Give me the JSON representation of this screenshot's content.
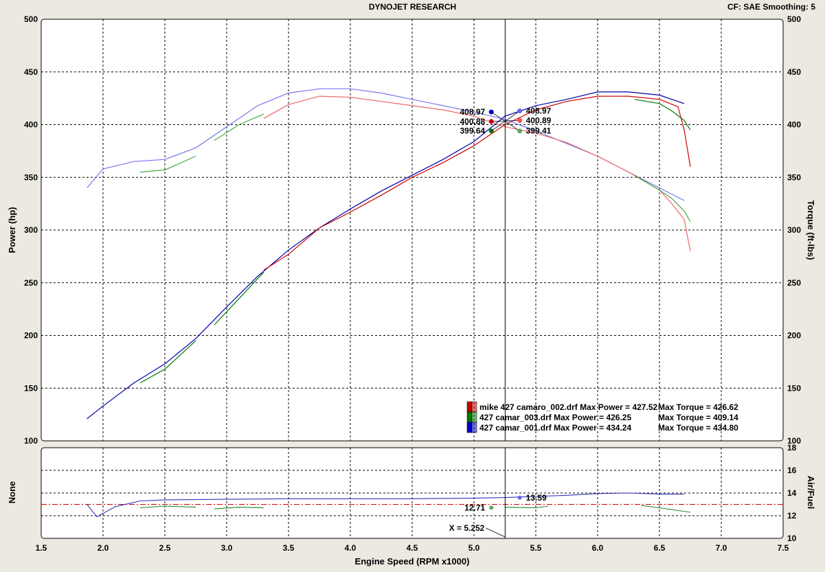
{
  "header": {
    "title": "DYNOJET RESEARCH",
    "config": "CF: SAE  Smoothing: 5"
  },
  "chart_data": [
    {
      "type": "line",
      "xlabel": "Engine Speed (RPM x1000)",
      "ylabel": "Power (hp)",
      "y2label": "Torque (ft-lbs)",
      "xlim": [
        1.5,
        7.5
      ],
      "ylim": [
        100,
        500
      ],
      "y2lim": [
        100,
        500
      ],
      "xticks": [
        "1.5",
        "2.0",
        "2.5",
        "3.0",
        "3.5",
        "4.0",
        "4.5",
        "5.0",
        "5.5",
        "6.0",
        "6.5",
        "7.0",
        "7.5"
      ],
      "yticks": [
        "100",
        "150",
        "200",
        "250",
        "300",
        "350",
        "400",
        "450",
        "500"
      ],
      "grid": true,
      "legend_position": "bottom-right",
      "legend": [
        {
          "name": "mike 427 camaro_002.drf",
          "power_label": "Max Power = 427.52",
          "torque_label": "Max Torque = 426.62",
          "color": "#cc0000"
        },
        {
          "name": "427 camar_003.drf",
          "power_label": "Max Power = 426.25",
          "torque_label": "Max Torque = 409.14",
          "color": "#007a00"
        },
        {
          "name": "427 camar_001.drf",
          "power_label": "Max Power = 434.24",
          "torque_label": "Max Torque = 434.80",
          "color": "#0000cc"
        }
      ],
      "series": [
        {
          "color": "#0000aa",
          "kind": "power",
          "x": [
            1.87,
            2.0,
            2.25,
            2.5,
            2.75,
            3.0,
            3.25,
            3.5,
            3.75,
            4.0,
            4.25,
            4.5,
            4.75,
            5.0,
            5.25,
            5.5,
            5.75,
            6.0,
            6.25,
            6.5,
            6.7
          ],
          "values": [
            121,
            133,
            155,
            173,
            197,
            227,
            256,
            281,
            302,
            320,
            337,
            352,
            367,
            384,
            408,
            418,
            424,
            431,
            431,
            428,
            420
          ]
        },
        {
          "color": "#cc0000",
          "kind": "power",
          "x": [
            3.3,
            3.5,
            3.75,
            4.0,
            4.25,
            4.5,
            4.75,
            5.0,
            5.25,
            5.5,
            5.75,
            6.0,
            6.25,
            6.5,
            6.65,
            6.7,
            6.75
          ],
          "values": [
            262,
            277,
            302,
            317,
            333,
            350,
            364,
            380,
            400,
            414,
            422,
            427,
            427,
            424,
            417,
            395,
            360
          ]
        },
        {
          "color": "#007700",
          "kind": "power",
          "x": [
            2.3,
            2.5,
            2.75
          ],
          "values": [
            155,
            168,
            195
          ]
        },
        {
          "color": "#007700",
          "kind": "power",
          "x": [
            2.9,
            3.1,
            3.3
          ],
          "values": [
            210,
            235,
            260
          ]
        },
        {
          "color": "#007700",
          "kind": "power",
          "x": [
            6.3,
            6.5,
            6.6,
            6.7,
            6.75
          ],
          "values": [
            424,
            420,
            413,
            404,
            395
          ]
        },
        {
          "color": "#7777ee",
          "kind": "torque",
          "x": [
            1.87,
            2.0,
            2.25,
            2.5,
            2.75,
            3.0,
            3.25,
            3.5,
            3.75,
            4.0,
            4.25,
            4.5,
            4.75,
            5.0,
            5.25,
            5.5,
            5.75,
            6.0,
            6.25,
            6.5,
            6.7
          ],
          "values": [
            340,
            358,
            365,
            367,
            378,
            398,
            418,
            430,
            434,
            434,
            430,
            424,
            418,
            412,
            405,
            394,
            382,
            370,
            355,
            340,
            328
          ]
        },
        {
          "color": "#ee6666",
          "kind": "torque",
          "x": [
            3.3,
            3.5,
            3.75,
            4.0,
            4.25,
            4.5,
            4.75,
            5.0,
            5.25,
            5.5,
            5.75,
            6.0,
            6.25,
            6.5,
            6.6,
            6.7,
            6.75
          ],
          "values": [
            406,
            419,
            427,
            426,
            422,
            418,
            414,
            408,
            398,
            392,
            383,
            370,
            355,
            338,
            325,
            310,
            280
          ]
        },
        {
          "color": "#44aa44",
          "kind": "torque",
          "x": [
            2.3,
            2.5,
            2.75
          ],
          "values": [
            355,
            357,
            370
          ]
        },
        {
          "color": "#44aa44",
          "kind": "torque",
          "x": [
            2.9,
            3.1,
            3.3
          ],
          "values": [
            385,
            400,
            410
          ]
        },
        {
          "color": "#44aa44",
          "kind": "torque",
          "x": [
            6.3,
            6.5,
            6.6,
            6.7,
            6.75
          ],
          "values": [
            352,
            338,
            330,
            318,
            308
          ]
        }
      ],
      "cursor": {
        "x": 5.252,
        "label": "X = 5.252",
        "left_values": [
          {
            "text": "408.97",
            "y": 412,
            "color": "#0000cc"
          },
          {
            "text": "400.88",
            "y": 403,
            "color": "#cc0000"
          },
          {
            "text": "399.64",
            "y": 394,
            "color": "#007a00"
          }
        ],
        "right_values": [
          {
            "text": "408.97",
            "y": 413,
            "color": "#6666ee"
          },
          {
            "text": "400.89",
            "y": 404,
            "color": "#ee5555"
          },
          {
            "text": "399.41",
            "y": 394,
            "color": "#55aa55"
          }
        ]
      }
    },
    {
      "type": "line",
      "ylabel": "None",
      "y2label": "Air/Fuel",
      "xlim": [
        1.5,
        7.5
      ],
      "y2lim": [
        10,
        18
      ],
      "y2ticks": [
        "10",
        "12",
        "14",
        "16",
        "18"
      ],
      "reference_line": 13.0,
      "series": [
        {
          "color": "#3333bb",
          "x": [
            1.87,
            1.95,
            2.1,
            2.3,
            2.5,
            3.0,
            3.5,
            4.0,
            4.5,
            5.0,
            5.25,
            5.5,
            5.75,
            6.0,
            6.25,
            6.5,
            6.7
          ],
          "values": [
            13.0,
            11.9,
            12.8,
            13.3,
            13.4,
            13.45,
            13.5,
            13.5,
            13.5,
            13.55,
            13.6,
            13.7,
            13.8,
            13.95,
            14.0,
            13.9,
            13.9
          ]
        },
        {
          "color": "#228822",
          "x": [
            2.3,
            2.5,
            2.75
          ],
          "values": [
            12.7,
            12.85,
            12.75
          ]
        },
        {
          "color": "#228822",
          "x": [
            2.9,
            3.1,
            3.3
          ],
          "values": [
            12.6,
            12.75,
            12.7
          ]
        },
        {
          "color": "#228822",
          "x": [
            5.25,
            5.5,
            5.6
          ],
          "values": [
            12.75,
            12.7,
            12.85
          ]
        },
        {
          "color": "#228822",
          "x": [
            6.35,
            6.5,
            6.75
          ],
          "values": [
            12.9,
            12.7,
            12.3
          ]
        }
      ],
      "cursor_values": [
        {
          "text": "13.59",
          "y": 13.59,
          "side": "right",
          "color": "#6666ee"
        },
        {
          "text": "12.71",
          "y": 12.71,
          "side": "left",
          "color": "#55aa55"
        }
      ]
    }
  ]
}
